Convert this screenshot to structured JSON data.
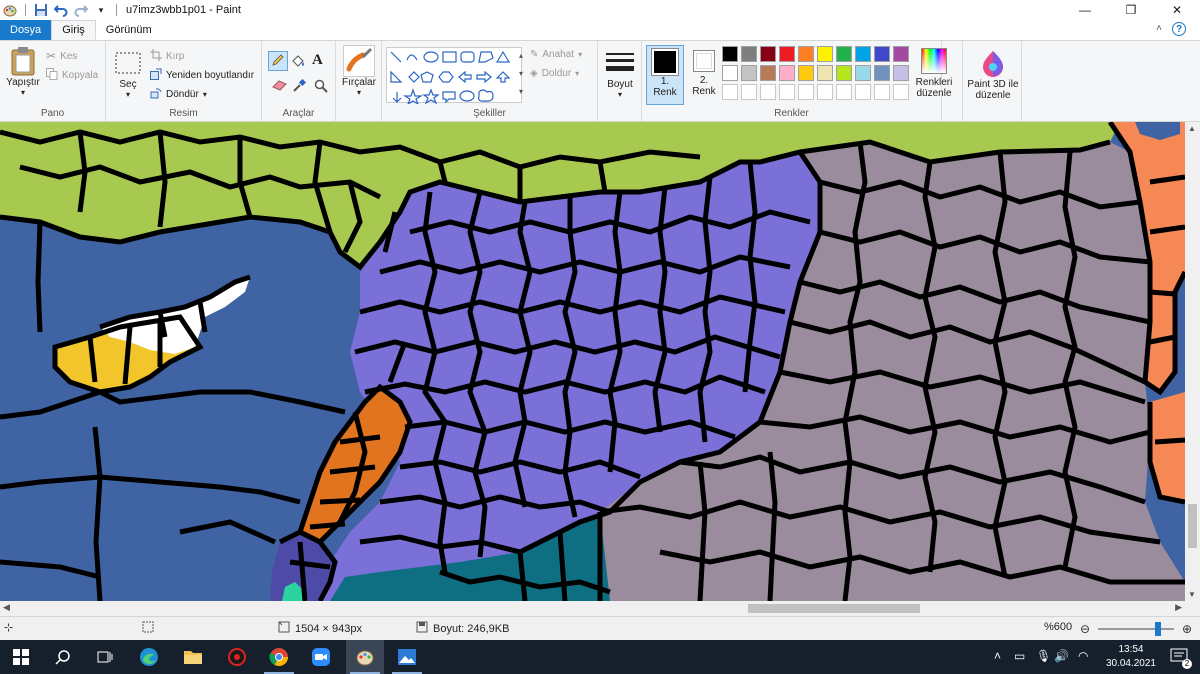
{
  "window": {
    "title": "u7imz3wbb1p01 - Paint",
    "controls": {
      "minimize": "—",
      "maximize": "❐",
      "close": "✕"
    }
  },
  "tabs": [
    "Dosya",
    "Giriş",
    "Görünüm"
  ],
  "ribbon": {
    "pano": {
      "label": "Pano",
      "paste": "Yapıştır",
      "cut": "Kes",
      "copy": "Kopyala"
    },
    "resim": {
      "label": "Resim",
      "select": "Seç",
      "crop": "Kırp",
      "resize": "Yeniden boyutlandır",
      "rotate": "Döndür"
    },
    "araclar": {
      "label": "Araçlar"
    },
    "brushes": {
      "label": "Fırçalar"
    },
    "sekiller": {
      "label": "Şekiller",
      "outline": "Anahat",
      "fill": "Doldur"
    },
    "size": {
      "label": "Boyut"
    },
    "color1": {
      "label1": "1.",
      "label2": "Renk",
      "color": "#000000"
    },
    "color2": {
      "label1": "2.",
      "label2": "Renk",
      "color": "#ffffff"
    },
    "renkler": {
      "label": "Renkler",
      "edit": "Renkleri düzenle",
      "palette_row1": [
        "#000000",
        "#7f7f7f",
        "#880015",
        "#ed1c24",
        "#ff7f27",
        "#fff200",
        "#22b14c",
        "#00a2e8",
        "#3f48cc",
        "#a349a4"
      ],
      "palette_row2": [
        "#ffffff",
        "#c3c3c3",
        "#b97a57",
        "#ffaec9",
        "#ffc90e",
        "#efe4b0",
        "#b5e61d",
        "#99d9ea",
        "#7092be",
        "#c8bfe7"
      ]
    },
    "paint3d": {
      "label": "Paint 3D ile düzenle"
    }
  },
  "map_colors": {
    "green": "#a8c94f",
    "sea": "#3f63a3",
    "purple": "#7b6fd8",
    "grey": "#9a8c9c",
    "orange": "#e2731f",
    "salmon": "#f58855",
    "yellow": "#f2c52a",
    "teal": "#0e6e82",
    "white": "#ffffff",
    "dark_purple": "#4e4ba8",
    "mint": "#2ad39f"
  },
  "status": {
    "dimensions": "1504 × 943px",
    "filesize": "Boyut: 246,9KB",
    "zoom": "%600"
  },
  "taskbar": {
    "time": "13:54",
    "date": "30.04.2021",
    "notif_count": "2"
  }
}
